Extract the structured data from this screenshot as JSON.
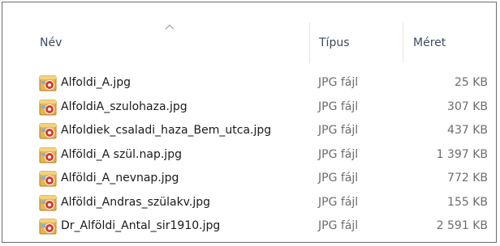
{
  "columns": {
    "name": "Név",
    "type": "Típus",
    "size": "Méret",
    "sort_direction": "ascending"
  },
  "icon": "jpg-file-icon",
  "files": [
    {
      "name": "Alfoldi_A.jpg",
      "type": "JPG fájl",
      "size": "25 KB"
    },
    {
      "name": "AlfoldiA_szulohaza.jpg",
      "type": "JPG fájl",
      "size": "307 KB"
    },
    {
      "name": "Alfoldiek_csaladi_haza_Bem_utca.jpg",
      "type": "JPG fájl",
      "size": "437 KB"
    },
    {
      "name": "Alföldi_A szül.nap.jpg",
      "type": "JPG fájl",
      "size": "1 397 KB"
    },
    {
      "name": "Alföldi_A_nevnap.jpg",
      "type": "JPG fájl",
      "size": "772 KB"
    },
    {
      "name": "Alföldi_Andras_szülakv.jpg",
      "type": "JPG fájl",
      "size": "155 KB"
    },
    {
      "name": "Dr_Alföldi_Antal_sir1910.jpg",
      "type": "JPG fájl",
      "size": "2 591 KB"
    }
  ]
}
